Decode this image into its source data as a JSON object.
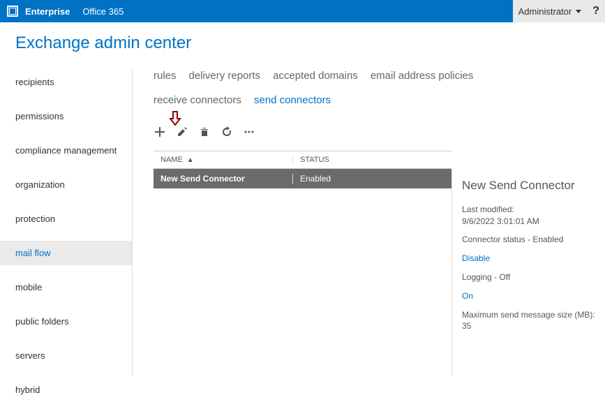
{
  "topbar": {
    "tab1": "Enterprise",
    "tab2": "Office 365",
    "user": "Administrator",
    "help": "?"
  },
  "page_title": "Exchange admin center",
  "sidebar": {
    "items": [
      {
        "label": "recipients"
      },
      {
        "label": "permissions"
      },
      {
        "label": "compliance management"
      },
      {
        "label": "organization"
      },
      {
        "label": "protection"
      },
      {
        "label": "mail flow"
      },
      {
        "label": "mobile"
      },
      {
        "label": "public folders"
      },
      {
        "label": "servers"
      },
      {
        "label": "hybrid"
      }
    ],
    "active_index": 5
  },
  "subnav": {
    "items": [
      {
        "label": "rules"
      },
      {
        "label": "delivery reports"
      },
      {
        "label": "accepted domains"
      },
      {
        "label": "email address policies"
      },
      {
        "label": "receive connectors"
      },
      {
        "label": "send connectors"
      }
    ],
    "active_index": 5
  },
  "table": {
    "columns": {
      "name": "NAME",
      "status": "STATUS"
    },
    "rows": [
      {
        "name": "New Send Connector",
        "status": "Enabled"
      }
    ]
  },
  "details": {
    "title": "New Send Connector",
    "last_modified_label": "Last modified:",
    "last_modified_value": "9/6/2022 3:01:01 AM",
    "connector_status": "Connector status - Enabled",
    "disable_link": "Disable",
    "logging": "Logging - Off",
    "on_link": "On",
    "max_size_label": "Maximum send message size (MB):",
    "max_size_value": "35"
  }
}
